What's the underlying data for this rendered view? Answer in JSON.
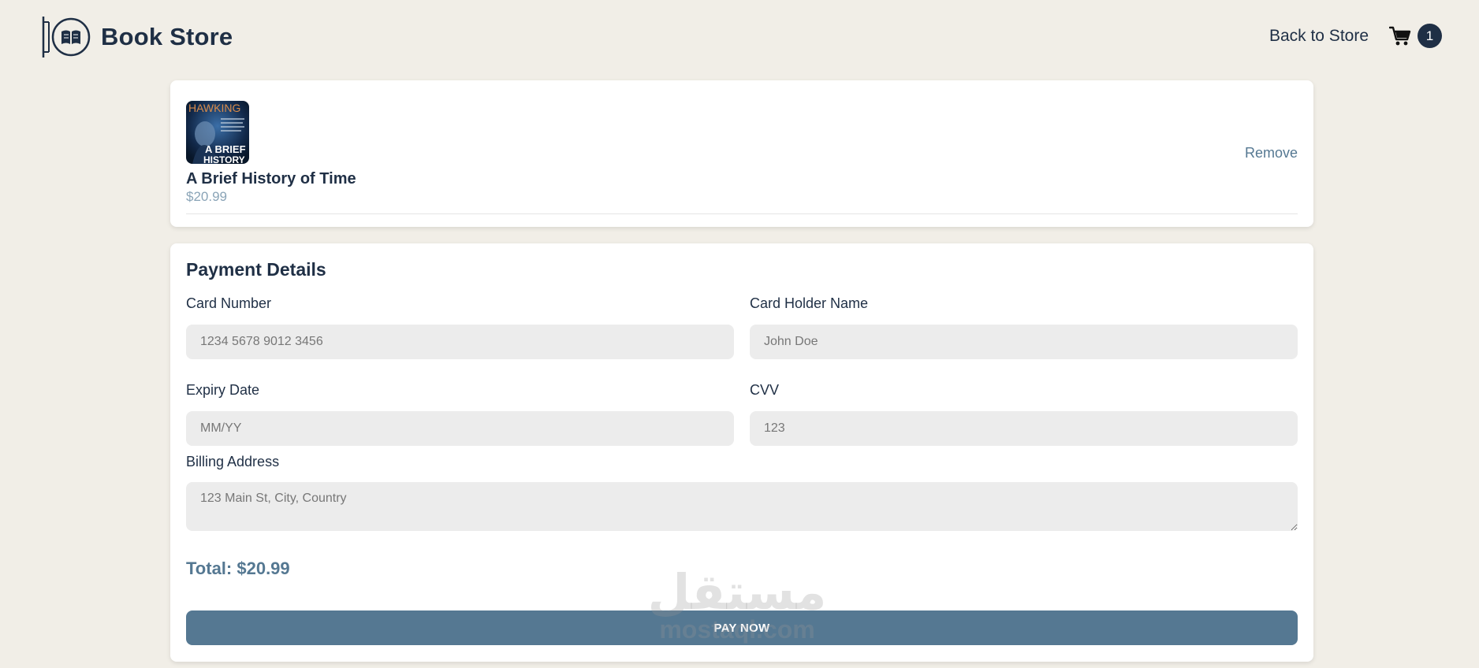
{
  "header": {
    "brand": "Book Store",
    "back_link": "Back to Store",
    "cart_count": "1",
    "logo_icon": "book-sign-icon",
    "cart_icon": "shopping-cart-icon"
  },
  "cart": {
    "items": [
      {
        "cover_text_top": "HAWKING",
        "cover_text_bottom": "A BRIEF HISTORY",
        "title": "A Brief History of Time",
        "price": "$20.99",
        "remove_label": "Remove"
      }
    ]
  },
  "payment": {
    "title": "Payment Details",
    "card_number": {
      "label": "Card Number",
      "placeholder": "1234 5678 9012 3456",
      "value": ""
    },
    "card_holder": {
      "label": "Card Holder Name",
      "placeholder": "John Doe",
      "value": ""
    },
    "expiry": {
      "label": "Expiry Date",
      "placeholder": "MM/YY",
      "value": ""
    },
    "cvv": {
      "label": "CVV",
      "placeholder": "123",
      "value": ""
    },
    "billing": {
      "label": "Billing Address",
      "placeholder": "123 Main St, City, Country",
      "value": ""
    },
    "total": "Total: $20.99",
    "pay_button": "PAY NOW"
  },
  "watermark": {
    "arabic": "مستقل",
    "latin": "mostaql.com"
  },
  "colors": {
    "background": "#f1eee7",
    "primary_dark": "#1f2f45",
    "accent": "#557892",
    "input_bg": "#ececec"
  }
}
